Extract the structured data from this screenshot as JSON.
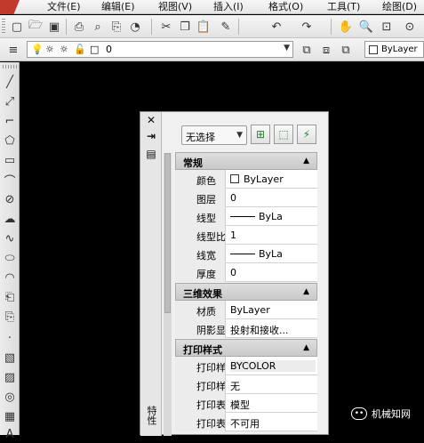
{
  "menu": [
    "文件(E)",
    "编辑(E)",
    "视图(V)",
    "插入(I)",
    "格式(O)",
    "工具(T)",
    "绘图(D)"
  ],
  "toolbar": {
    "standard_icons": [
      "new-icon",
      "open-icon",
      "save-icon",
      "print-icon",
      "print-preview-icon",
      "publish-icon",
      "plot-icon",
      "cut-icon",
      "copy-icon",
      "paste-icon",
      "match-properties-icon",
      "undo-icon",
      "redo-icon",
      "pan-icon",
      "zoom-icon",
      "zoom-window-icon",
      "zoom-previous-icon"
    ],
    "layer_value": "0",
    "color_value": "ByLayer"
  },
  "palette": {
    "selection": "无选择",
    "side_title": "特性",
    "sections": [
      {
        "title": "常规",
        "rows": [
          {
            "label": "颜色",
            "value": "ByLayer",
            "swatch": true
          },
          {
            "label": "图层",
            "value": "0"
          },
          {
            "label": "线型",
            "value": "ByLa",
            "line": true
          },
          {
            "label": "线型比例",
            "value": "1"
          },
          {
            "label": "线宽",
            "value": "ByLa",
            "line": true
          },
          {
            "label": "厚度",
            "value": "0"
          }
        ]
      },
      {
        "title": "三维效果",
        "rows": [
          {
            "label": "材质",
            "value": "ByLayer"
          },
          {
            "label": "阴影显示",
            "value": "投射和接收..."
          }
        ]
      },
      {
        "title": "打印样式",
        "rows": [
          {
            "label": "打印样式",
            "value": "BYCOLOR"
          },
          {
            "label": "打印样...",
            "value": "无"
          },
          {
            "label": "打印表...",
            "value": "模型"
          },
          {
            "label": "打印表...",
            "value": "不可用"
          }
        ]
      }
    ]
  },
  "watermark": "机械知网"
}
